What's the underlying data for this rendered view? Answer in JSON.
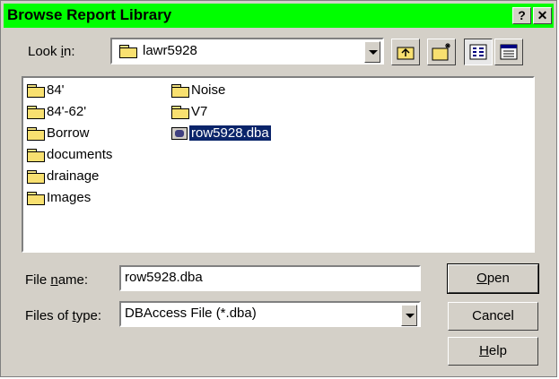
{
  "window": {
    "title": "Browse Report Library",
    "help_button": "?",
    "close_button": "✕"
  },
  "lookin": {
    "label_pre": "Look ",
    "label_u": "i",
    "label_post": "n:",
    "value": "lawr5928"
  },
  "files": [
    {
      "name": "84'",
      "type": "folder"
    },
    {
      "name": "84'-62'",
      "type": "folder"
    },
    {
      "name": "Borrow",
      "type": "folder"
    },
    {
      "name": "documents",
      "type": "folder"
    },
    {
      "name": "drainage",
      "type": "folder"
    },
    {
      "name": "Images",
      "type": "folder"
    },
    {
      "name": "Noise",
      "type": "folder"
    },
    {
      "name": "V7",
      "type": "folder"
    },
    {
      "name": "row5928.dba",
      "type": "file",
      "selected": true
    }
  ],
  "filename": {
    "label_pre": "File ",
    "label_u": "n",
    "label_post": "ame:",
    "value": "row5928.dba"
  },
  "filetype": {
    "label_pre": "Files of ",
    "label_u": "t",
    "label_post": "ype:",
    "value": "DBAccess File (*.dba)"
  },
  "buttons": {
    "open_u": "O",
    "open_rest": "pen",
    "cancel": "Cancel",
    "help_u": "H",
    "help_rest": "elp"
  }
}
